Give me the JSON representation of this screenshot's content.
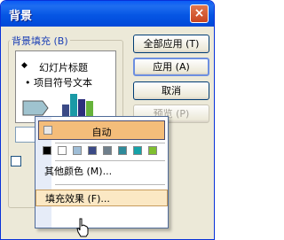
{
  "window": {
    "title": "背景",
    "close_label": "×"
  },
  "group": {
    "label": "背景填充 (B)"
  },
  "preview": {
    "title": "幻灯片标题",
    "bullet_text": "• 项目符号文本",
    "diamond_glyph": "◆"
  },
  "buttons": {
    "apply_all": "全部应用 (T)",
    "apply": "应用 (A)",
    "cancel": "取消",
    "preview": "预览 (P)"
  },
  "select": {
    "arrow_glyph": "▼"
  },
  "menu": {
    "auto_label": "自动",
    "swatch_colors": [
      "#000000",
      "#ffffff",
      "#9fbdd6",
      "#3b4a86",
      "#6f7f8c",
      "#2f8a9a",
      "#15a2a8",
      "#7fbf2f"
    ],
    "more_colors": "其他颜色 (M)...",
    "fill_effects": "填充效果 (F)..."
  },
  "colors": {
    "titlebar": "#0656e4",
    "menu_highlight": "#f4bd7a",
    "group_label": "#1b3fb5"
  }
}
